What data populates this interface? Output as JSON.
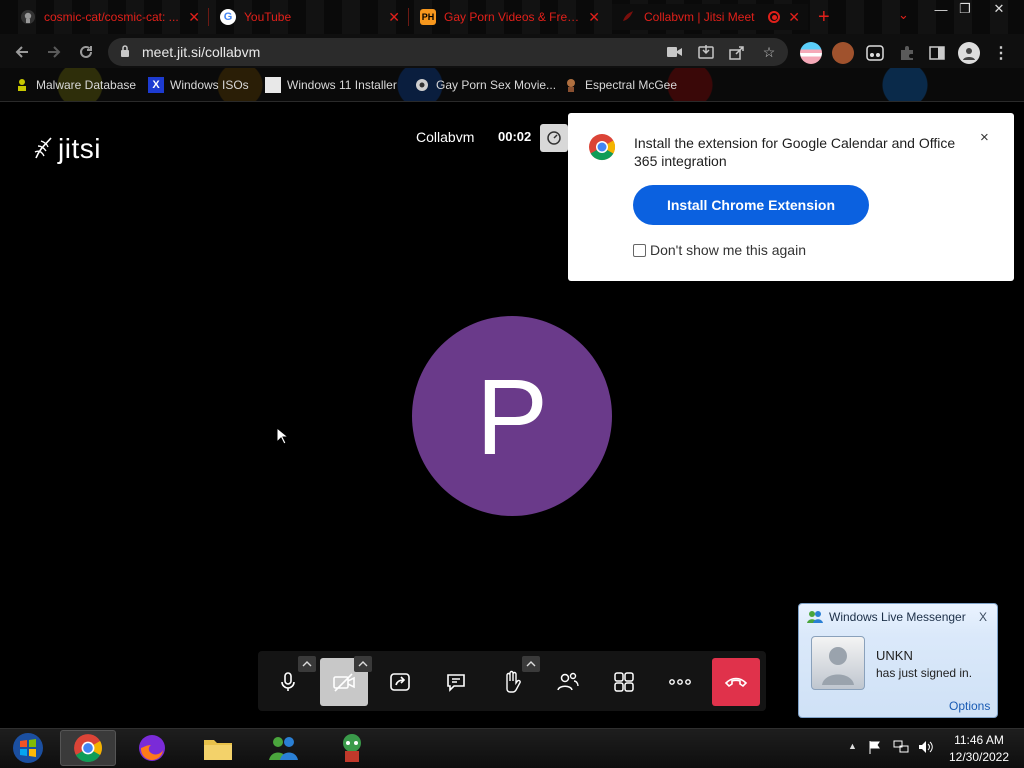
{
  "browser": {
    "tabs": [
      {
        "title": "cosmic-cat/cosmic-cat: ...",
        "icon": "github-icon"
      },
      {
        "title": "YouTube",
        "icon": "google-icon"
      },
      {
        "title": "Gay Porn Videos & Free ...",
        "icon": "ph-icon",
        "icon_text": "PH"
      },
      {
        "title": "Collabvm | Jitsi Meet",
        "icon": "jitsi-icon"
      }
    ],
    "new_tab": "+",
    "url": "meet.jit.si/collabvm",
    "bookmarks": [
      {
        "label": "Malware Database",
        "icon": "malware-db-icon"
      },
      {
        "label": "Windows ISOs",
        "icon": "x-icon",
        "icon_text": "X"
      },
      {
        "label": "Windows 11 Installer",
        "icon": "installer-icon"
      },
      {
        "label": "Gay Porn Sex Movie...",
        "icon": "bookmark-page-icon"
      },
      {
        "label": "Espectral McGee",
        "icon": "character-icon"
      }
    ],
    "accent_color": "#e0201a"
  },
  "meeting": {
    "logo_text": "jitsi",
    "name": "Collabvm",
    "timer": "00:02",
    "avatar_initial": "P",
    "avatar_color": "#6a3a8a"
  },
  "popup": {
    "message": "Install the extension for Google Calendar and Office 365 integration",
    "install_label": "Install Chrome Extension",
    "dont_show_label": "Don't show me this again",
    "close": "×"
  },
  "toolbox": {
    "buttons": [
      "microphone",
      "camera-off",
      "share-screen",
      "chat",
      "raise-hand",
      "participants",
      "tile-view",
      "more",
      "hang-up"
    ],
    "hangup_color": "#e0324b"
  },
  "messenger": {
    "title": "Windows Live Messenger",
    "user": "UNKN",
    "status": "has just signed in.",
    "options": "Options",
    "close": "X"
  },
  "taskbar": {
    "time": "11:46 AM",
    "date": "12/30/2022"
  }
}
